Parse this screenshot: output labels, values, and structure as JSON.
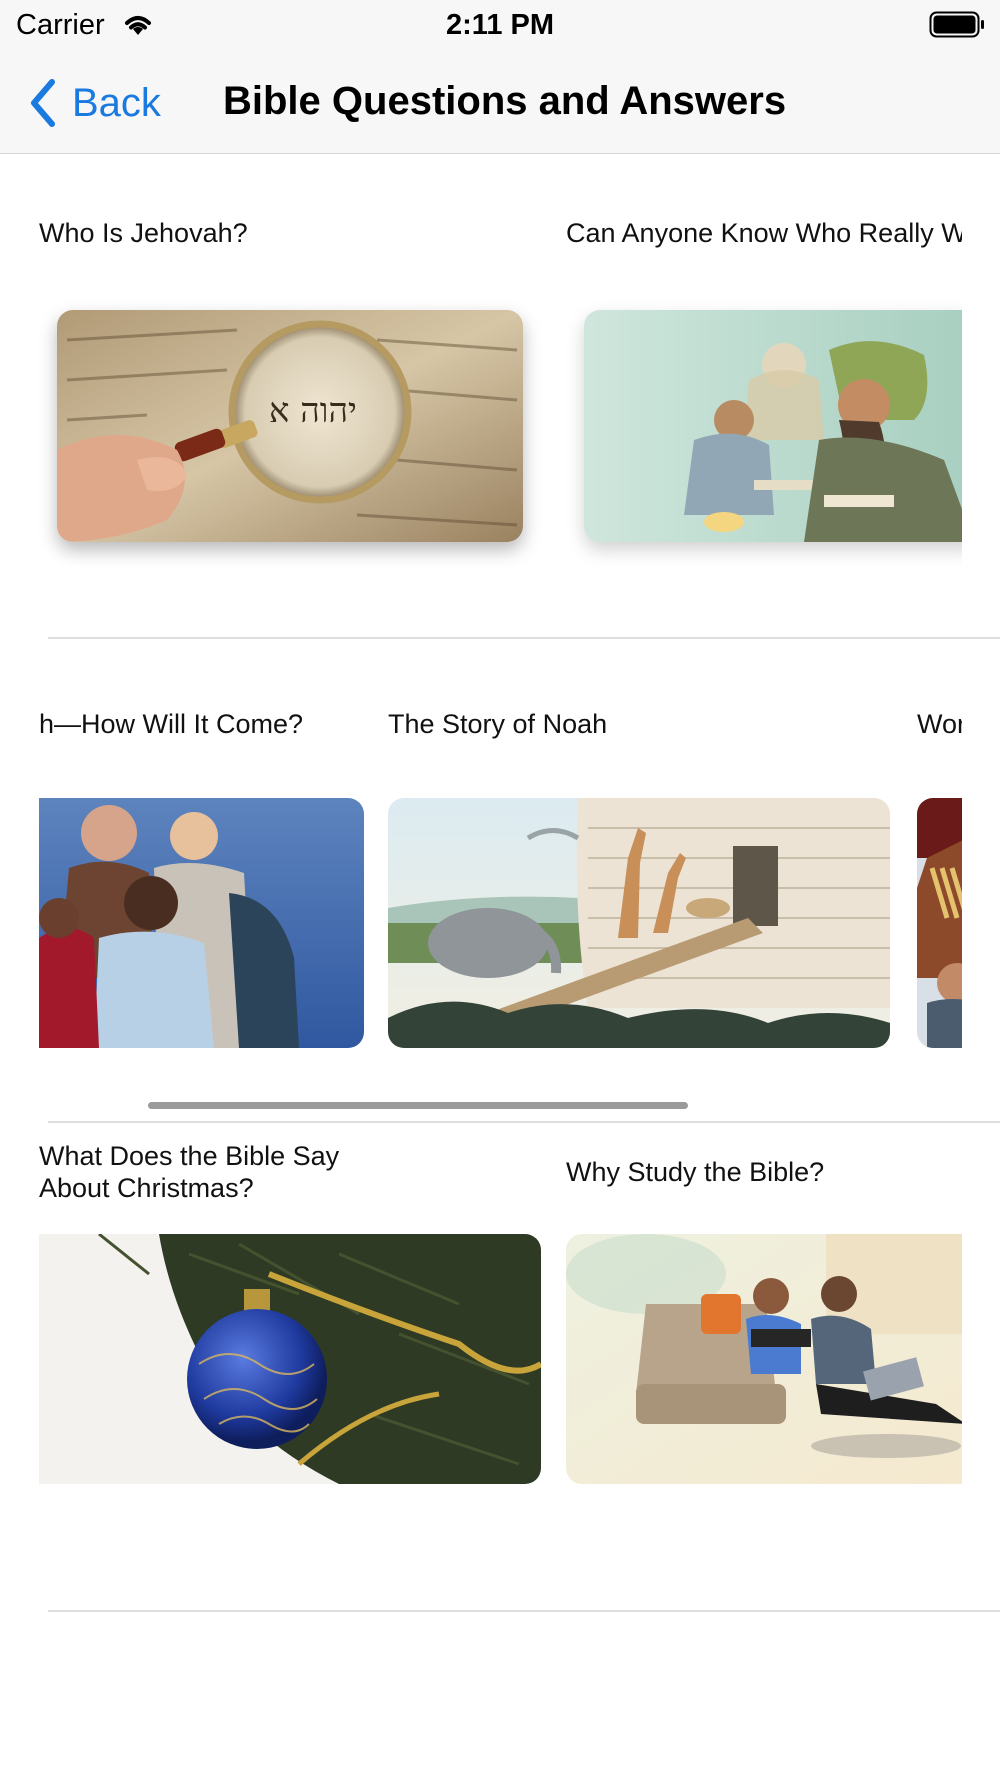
{
  "status_bar": {
    "carrier": "Carrier",
    "time": "2:11 PM",
    "wifi_icon": "wifi-icon",
    "battery_icon": "battery-full-icon"
  },
  "nav": {
    "back_label": "Back",
    "back_icon": "chevron-left-icon",
    "title": "Bible Questions and Answers"
  },
  "colors": {
    "accent": "#1a7ae0",
    "divider": "#dedede",
    "nav_background": "#f7f7f7"
  },
  "sections": [
    {
      "cards": [
        {
          "title": "Who Is Jehovah?",
          "image": "magnifying-glass-over-hebrew-scroll"
        },
        {
          "title": "Can Anyone Know Who Really W",
          "image": "ancient-scribes-writing"
        }
      ]
    },
    {
      "cards": [
        {
          "title": "h—How Will It Come?",
          "image": "group-of-diverse-people"
        },
        {
          "title": "The Story of Noah",
          "image": "animals-entering-ark"
        },
        {
          "title": "Wor",
          "image": "partial-figure-with-wheat"
        }
      ]
    },
    {
      "cards": [
        {
          "title_line1": "What Does the Bible Say",
          "title_line2": "About Christmas?",
          "image": "blue-christmas-ornament"
        },
        {
          "title": "Why Study the Bible?",
          "image": "couple-studying-bible-on-sofa"
        }
      ]
    }
  ]
}
